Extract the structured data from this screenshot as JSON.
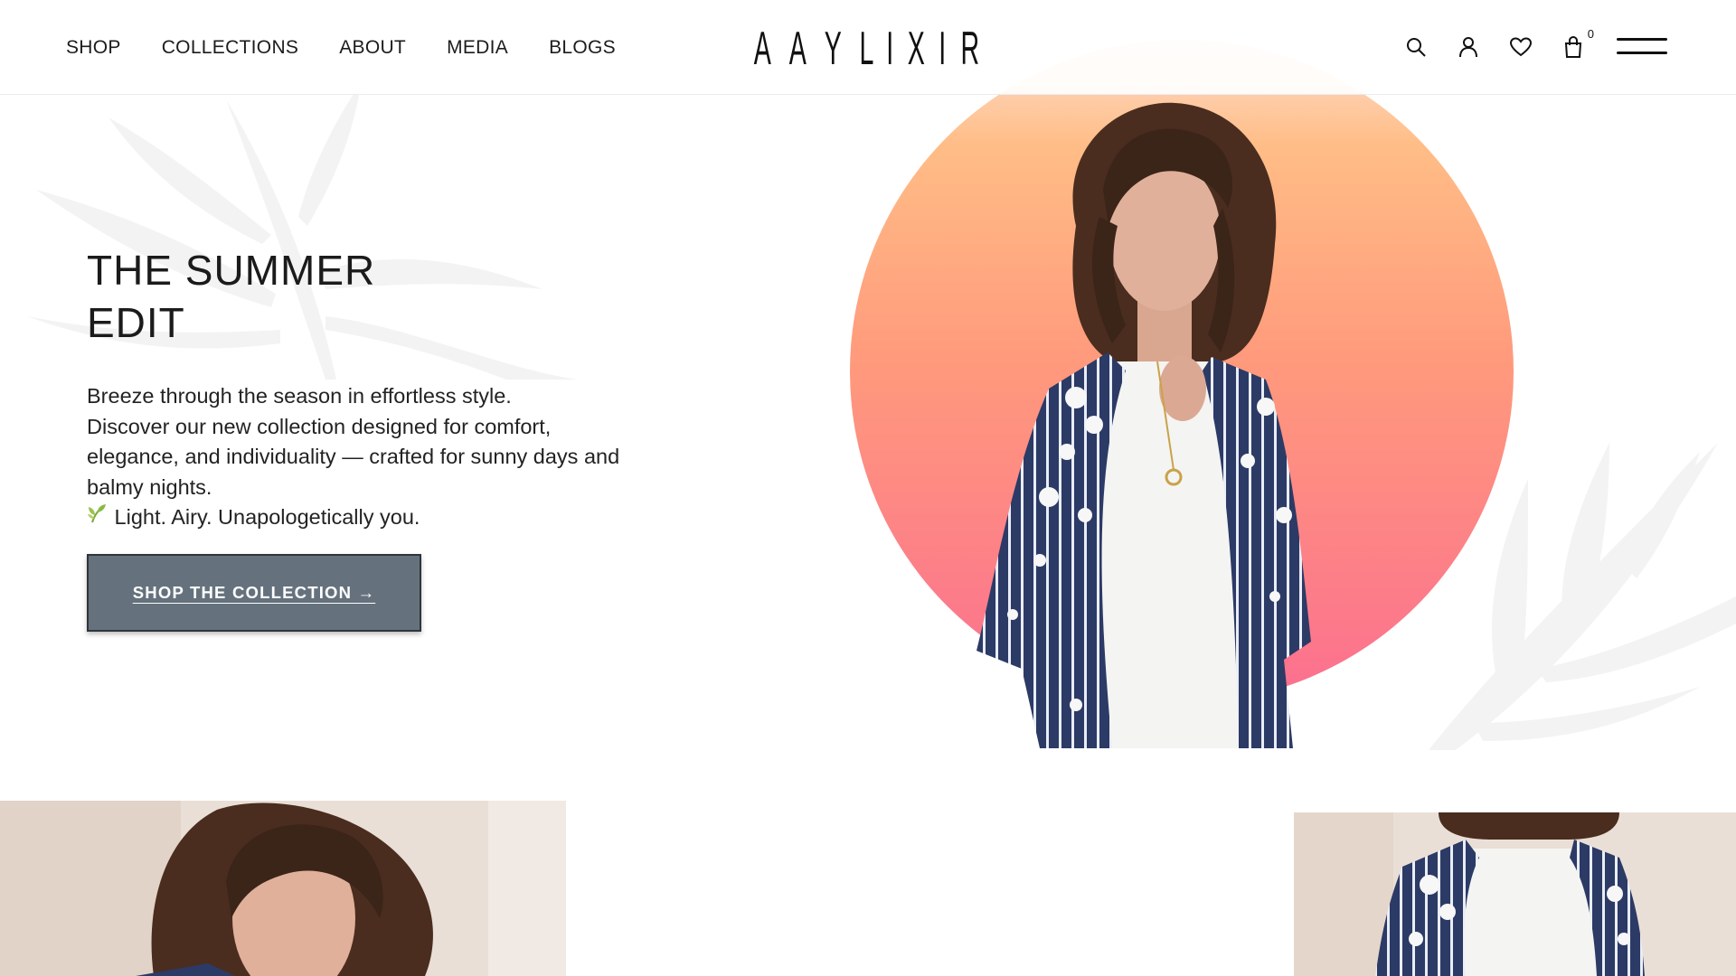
{
  "header": {
    "nav": [
      {
        "label": "SHOP"
      },
      {
        "label": "COLLECTIONS"
      },
      {
        "label": "ABOUT"
      },
      {
        "label": "MEDIA"
      },
      {
        "label": "BLOGS"
      }
    ],
    "logo_letters": [
      "A",
      "A",
      "Y",
      "L",
      "I",
      "X",
      "I",
      "R"
    ],
    "icons": {
      "search": "search-icon",
      "account": "user-icon",
      "wishlist": "heart-icon",
      "cart": "shopping-bag-icon",
      "menu": "hamburger-menu-icon"
    },
    "cart_count": "0"
  },
  "hero": {
    "title_lines": [
      "THE SUMMER",
      "EDIT"
    ],
    "description_lines": [
      "Breeze through the season in effortless style.",
      "Discover our new collection designed for comfort,",
      "elegance, and individuality — crafted for sunny days and",
      "balmy nights."
    ],
    "tagline": "Light. Airy. Unapologetically you.",
    "tagline_icon": "sprout-icon",
    "cta_label": "SHOP THE COLLECTION →",
    "circle_gradient": [
      "#fedecf",
      "#ffbd86",
      "#ff9a7c",
      "#fb6f8f"
    ],
    "cta_color": "#65727d"
  },
  "products": [
    {
      "image": "model-portrait-photo"
    },
    {
      "image": "model-kimono-photo"
    }
  ]
}
